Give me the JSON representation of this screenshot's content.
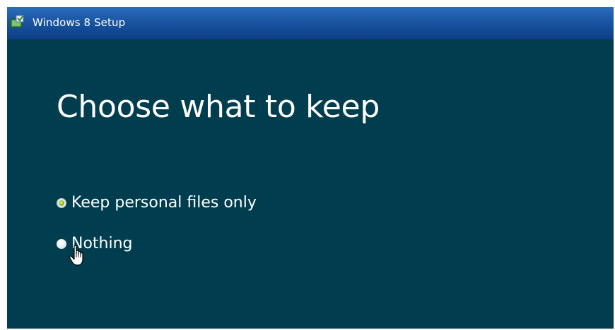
{
  "window": {
    "title": "Windows 8 Setup",
    "title_icon": "setup-icon"
  },
  "main": {
    "heading": "Choose what to keep",
    "options": [
      {
        "label": "Keep personal files only",
        "selected": true
      },
      {
        "label": "Nothing",
        "selected": false
      }
    ]
  },
  "colors": {
    "background": "#003e4f",
    "titlebar": "#1d5aa8",
    "text": "#ffffff"
  },
  "pointer": "hand-cursor-icon"
}
